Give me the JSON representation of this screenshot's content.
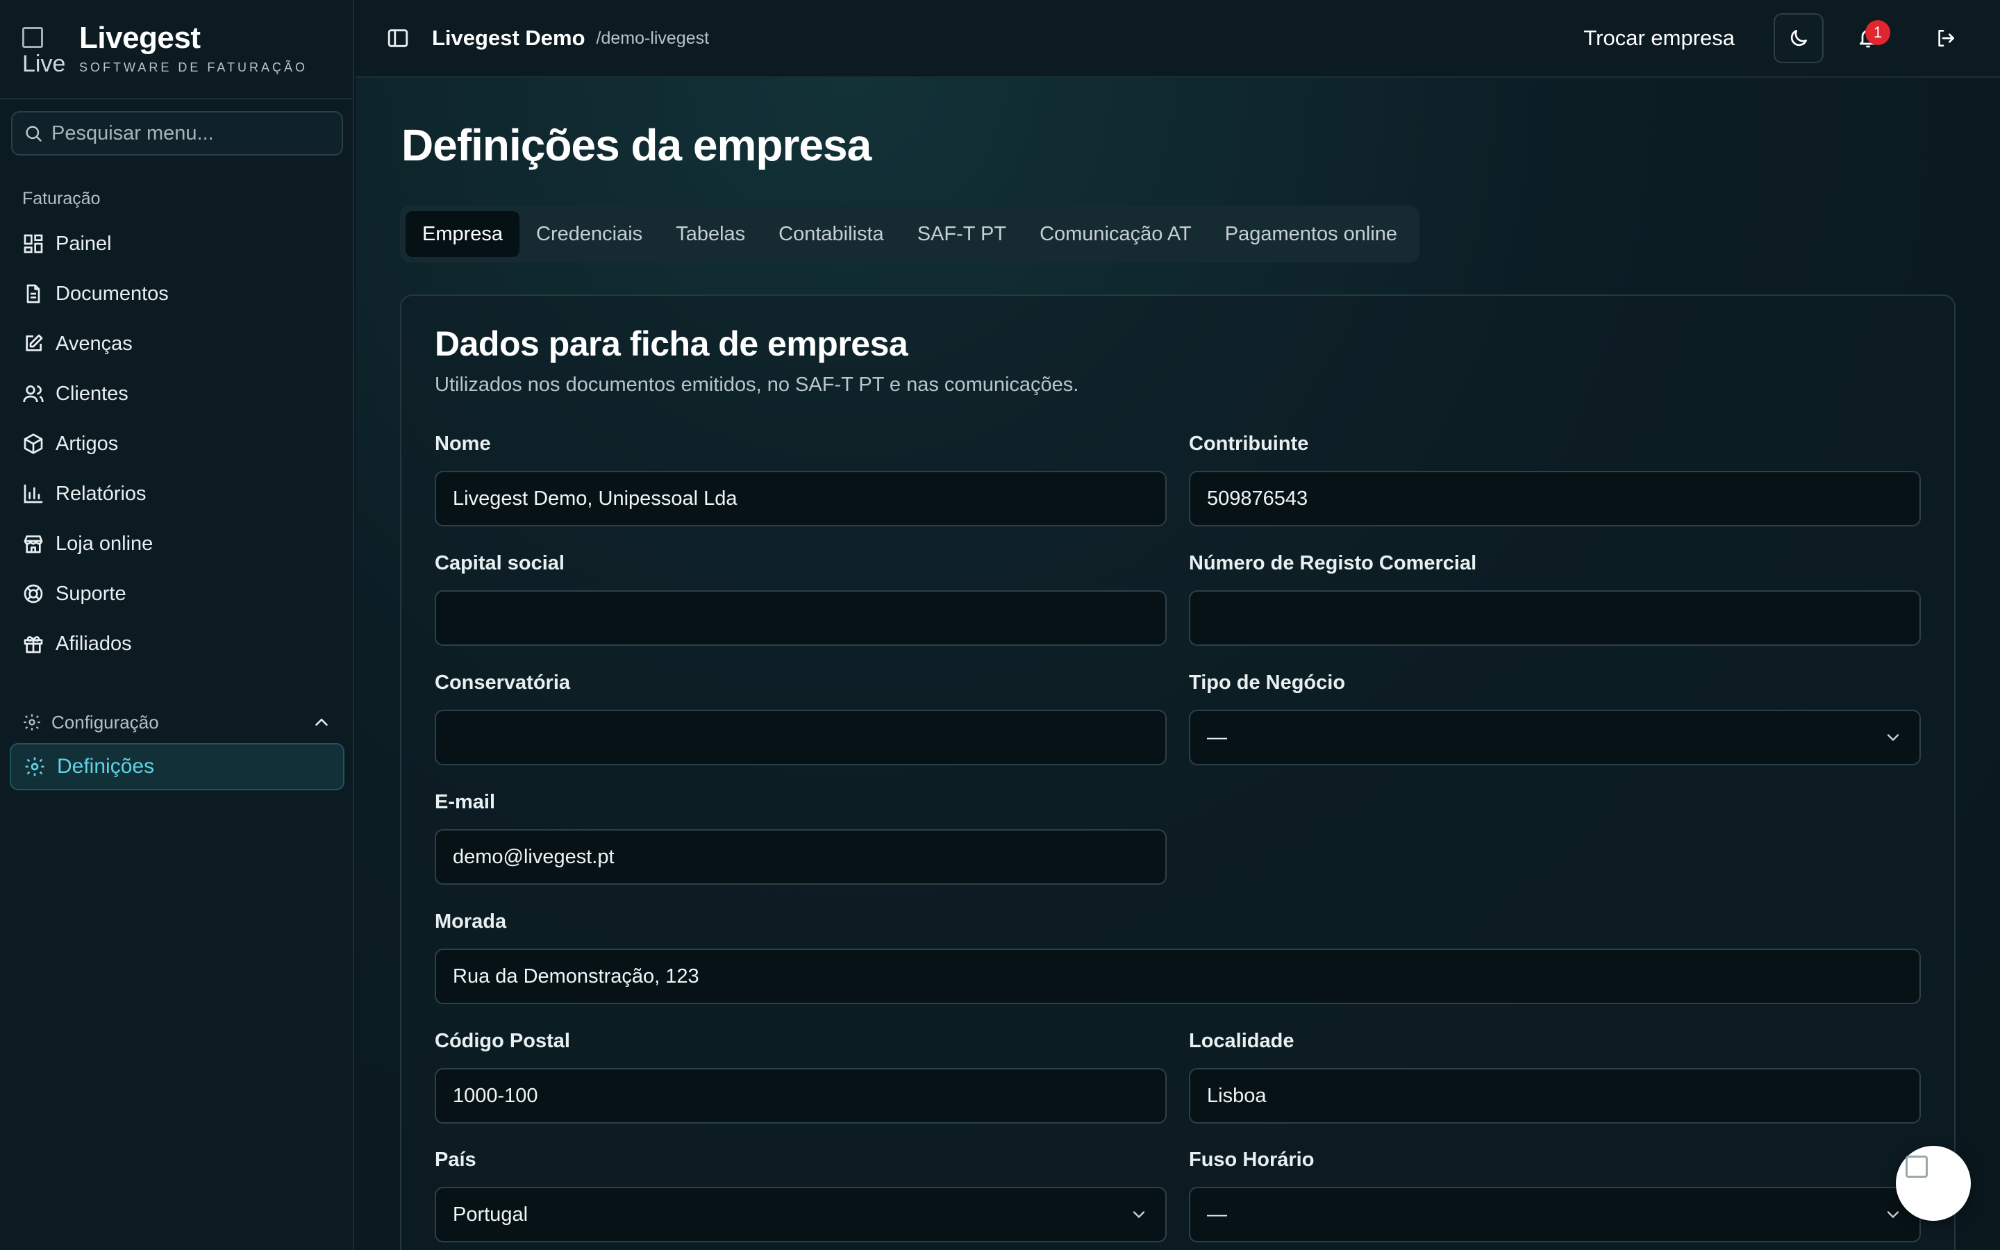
{
  "brand": {
    "logo_alt": "Live",
    "name": "Livegest",
    "subtitle": "SOFTWARE DE FATURAÇÃO"
  },
  "search": {
    "placeholder": "Pesquisar menu..."
  },
  "sidebar": {
    "section_label": "Faturação",
    "items": [
      {
        "label": "Painel",
        "icon": "dashboard-icon"
      },
      {
        "label": "Documentos",
        "icon": "document-icon"
      },
      {
        "label": "Avenças",
        "icon": "edit-icon"
      },
      {
        "label": "Clientes",
        "icon": "users-icon"
      },
      {
        "label": "Artigos",
        "icon": "package-icon"
      },
      {
        "label": "Relatórios",
        "icon": "bar-chart-icon"
      },
      {
        "label": "Loja online",
        "icon": "store-icon"
      },
      {
        "label": "Suporte",
        "icon": "lifebuoy-icon"
      },
      {
        "label": "Afiliados",
        "icon": "gift-icon"
      }
    ],
    "config_label": "Configuração",
    "active_item": "Definições"
  },
  "header": {
    "company": "Livegest Demo",
    "slug": "/demo-livegest",
    "switch_label": "Trocar empresa",
    "notification_count": "1"
  },
  "main": {
    "title": "Definições da empresa",
    "tabs": [
      "Empresa",
      "Credenciais",
      "Tabelas",
      "Contabilista",
      "SAF-T PT",
      "Comunicação AT",
      "Pagamentos online"
    ],
    "active_tab": "Empresa",
    "card": {
      "title": "Dados para ficha de empresa",
      "description": "Utilizados nos documentos emitidos, no SAF-T PT e nas comunicações."
    },
    "fields": {
      "nome": {
        "label": "Nome",
        "value": "Livegest Demo, Unipessoal Lda"
      },
      "contribuinte": {
        "label": "Contribuinte",
        "value": "509876543"
      },
      "capital": {
        "label": "Capital social",
        "value": ""
      },
      "registo": {
        "label": "Número de Registo Comercial",
        "value": ""
      },
      "conservatoria": {
        "label": "Conservatória",
        "value": ""
      },
      "tipo": {
        "label": "Tipo de Negócio",
        "value": "—"
      },
      "email": {
        "label": "E-mail",
        "value": "demo@livegest.pt"
      },
      "morada": {
        "label": "Morada",
        "value": "Rua da Demonstração, 123"
      },
      "codigo_postal": {
        "label": "Código Postal",
        "value": "1000-100"
      },
      "localidade": {
        "label": "Localidade",
        "value": "Lisboa"
      },
      "pais": {
        "label": "País",
        "value": "Portugal"
      },
      "fuso": {
        "label": "Fuso Horário",
        "value": "—"
      }
    }
  },
  "colors": {
    "accent": "#5fd3e4",
    "badge": "#e0262f",
    "background": "#0b1a20"
  }
}
